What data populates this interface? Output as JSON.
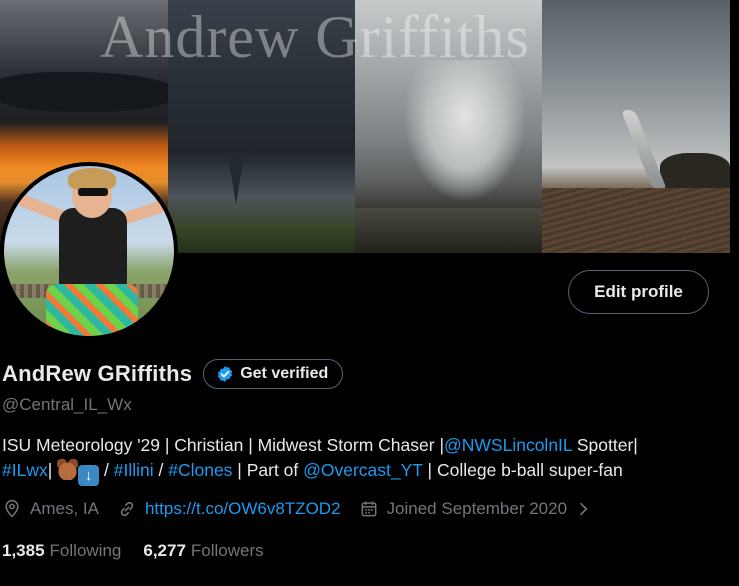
{
  "banner": {
    "title": "Andrew Griffiths"
  },
  "header": {
    "edit_profile_label": "Edit profile",
    "get_verified_label": "Get verified"
  },
  "profile": {
    "display_name": "AndRew GRiffiths",
    "handle": "@Central_IL_Wx",
    "bio": {
      "line1_part1": "ISU Meteorology '29 | Christian | Midwest Storm Chaser |",
      "line1_link": "@NWSLincolnIL",
      "line1_part2": " Spotter|",
      "line2_hashtag1": "#ILwx",
      "line2_sep1": "| ",
      "line2_sep2": " / ",
      "line2_hashtag2": "#Illini",
      "line2_sep3": " / ",
      "line2_hashtag3": "#Clones",
      "line2_text1": " | Part of ",
      "line2_link": "@Overcast_YT",
      "line2_text2": " | College b-ball super-fan"
    },
    "location": "Ames, IA",
    "website": "https://t.co/OW6v8TZOD2",
    "joined": "Joined September 2020",
    "following_count": "1,385",
    "following_label": "Following",
    "followers_count": "6,277",
    "followers_label": "Followers"
  },
  "icons": [
    "location-pin-icon",
    "link-icon",
    "calendar-icon",
    "chevron-right-icon",
    "verified-badge-icon",
    "bear-emoji-icon",
    "down-arrow-emoji-icon"
  ],
  "colors": {
    "background": "#000000",
    "text": "#e7e9ea",
    "muted": "#71767b",
    "link": "#1d9bf0",
    "border": "#536471"
  }
}
